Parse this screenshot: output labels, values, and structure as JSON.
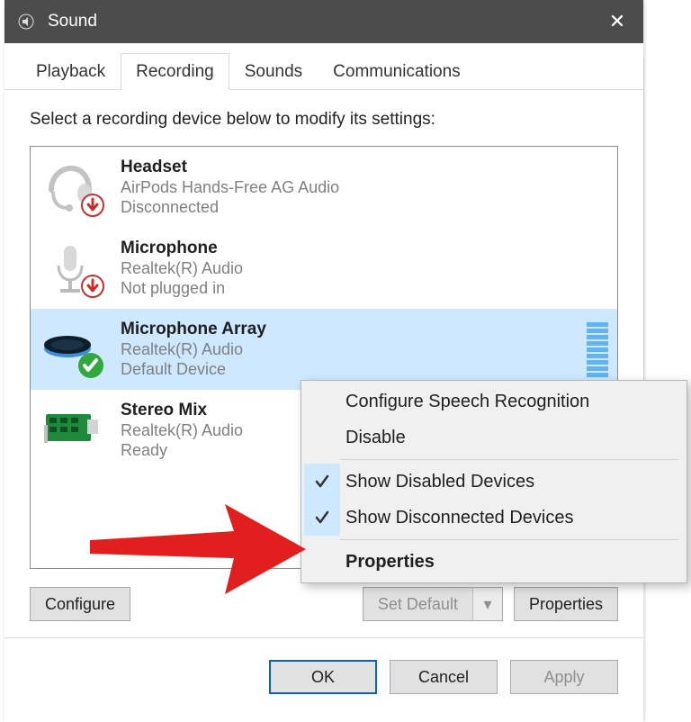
{
  "window": {
    "title": "Sound",
    "close_glyph": "✕"
  },
  "tabs": [
    {
      "label": "Playback",
      "active": false
    },
    {
      "label": "Recording",
      "active": true
    },
    {
      "label": "Sounds",
      "active": false
    },
    {
      "label": "Communications",
      "active": false
    }
  ],
  "prompt": "Select a recording device below to modify its settings:",
  "devices": [
    {
      "name": "Headset",
      "provider": "AirPods Hands-Free AG Audio",
      "status": "Disconnected",
      "badge": "down",
      "selected": false
    },
    {
      "name": "Microphone",
      "provider": "Realtek(R) Audio",
      "status": "Not plugged in",
      "badge": "down",
      "selected": false
    },
    {
      "name": "Microphone Array",
      "provider": "Realtek(R) Audio",
      "status": "Default Device",
      "badge": "check",
      "selected": true
    },
    {
      "name": "Stereo Mix",
      "provider": "Realtek(R) Audio",
      "status": "Ready",
      "badge": "none",
      "selected": false
    }
  ],
  "buttons": {
    "configure": "Configure",
    "set_default": "Set Default",
    "properties": "Properties",
    "ok": "OK",
    "cancel": "Cancel",
    "apply": "Apply"
  },
  "context_menu": {
    "items": [
      {
        "label": "Configure Speech Recognition",
        "checked": false,
        "bold": false
      },
      {
        "label": "Disable",
        "checked": false,
        "bold": false
      },
      {
        "sep": true
      },
      {
        "label": "Show Disabled Devices",
        "checked": true,
        "bold": false
      },
      {
        "label": "Show Disconnected Devices",
        "checked": true,
        "bold": false
      },
      {
        "sep": true
      },
      {
        "label": "Properties",
        "checked": false,
        "bold": true
      }
    ]
  }
}
